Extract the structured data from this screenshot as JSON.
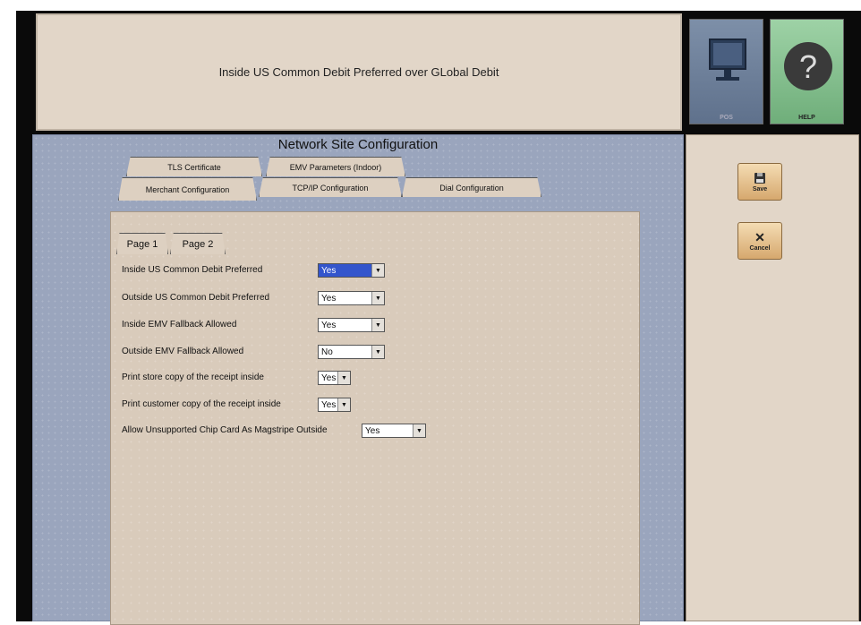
{
  "header": {
    "message": "Inside US Common Debit Preferred over GLobal Debit"
  },
  "tiles": {
    "pos_label": "POS",
    "help_label": "HELP"
  },
  "main": {
    "title": "Network Site Configuration",
    "tabs_back": [
      "TLS Certificate",
      "EMV Parameters (Indoor)"
    ],
    "tabs_front": [
      "Merchant Configuration",
      "TCP/IP Configuration",
      "Dial Configuration"
    ],
    "subtabs": [
      "Page 1",
      "Page 2"
    ],
    "fields": [
      {
        "label": "Inside US Common Debit Preferred",
        "value": "Yes"
      },
      {
        "label": "Outside US Common Debit Preferred",
        "value": "Yes"
      },
      {
        "label": "Inside EMV Fallback Allowed",
        "value": "Yes"
      },
      {
        "label": "Outside EMV Fallback Allowed",
        "value": "No"
      },
      {
        "label": "Print store copy of the receipt inside",
        "value": "Yes"
      },
      {
        "label": "Print customer copy of the receipt inside",
        "value": "Yes"
      },
      {
        "label": "Allow Unsupported Chip Card As Magstripe Outside",
        "value": "Yes"
      }
    ]
  },
  "side": {
    "save_label": "Save",
    "cancel_label": "Cancel"
  },
  "icons": {
    "pos": "monitor-icon",
    "help": "question-icon",
    "save": "floppy-disk-icon",
    "cancel": "x-icon",
    "dropdown": "triangle-down-icon"
  },
  "colors": {
    "highlight": "#e040e0",
    "selection": "#3355cc"
  }
}
